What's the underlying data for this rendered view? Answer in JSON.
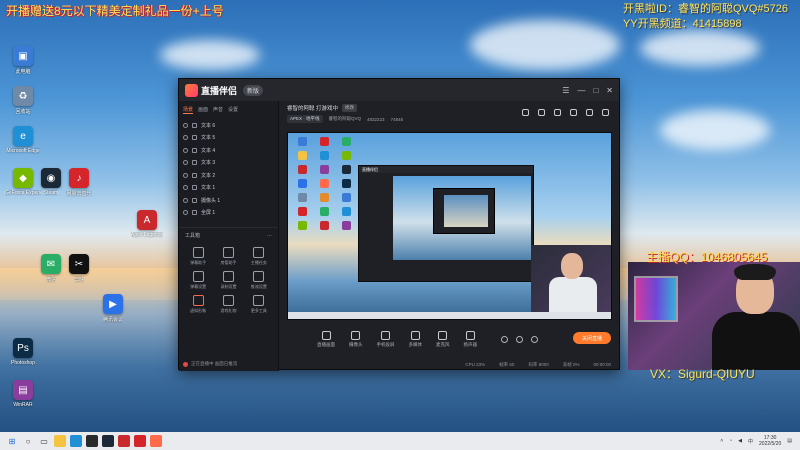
{
  "overlay": {
    "top_left": "开播赠送8元以下精美定制礼品一份+上号",
    "id_line": "开黑啦ID：睿智的阿聪QVQ#5726",
    "yy_line": "YY开黑频道：41415898",
    "qq_line": "主播QQ：1046805645",
    "vx_line": "VX：Sigurd-QIUYU"
  },
  "desktop_icons": [
    {
      "label": "此电脑",
      "color": "#3a7bd5",
      "glyph": "▣"
    },
    {
      "label": "回收站",
      "color": "#6f8aa6",
      "glyph": "♻"
    },
    {
      "label": "Microsoft Edge",
      "color": "#1f8fd6",
      "glyph": "e"
    },
    {
      "label": "GeForce Experience",
      "color": "#76b900",
      "glyph": "◆"
    },
    {
      "label": "Steam",
      "color": "#1b2838",
      "glyph": "◉"
    },
    {
      "label": "网易云音乐",
      "color": "#d6252a",
      "glyph": "♪"
    },
    {
      "label": "微信",
      "color": "#2aae67",
      "glyph": "✉"
    },
    {
      "label": "剪映",
      "color": "#111111",
      "glyph": "✂"
    },
    {
      "label": "腾讯会议",
      "color": "#2b72e8",
      "glyph": "▶"
    },
    {
      "label": "Apex Legends",
      "color": "#c9282d",
      "glyph": "A"
    },
    {
      "label": "Photoshop",
      "color": "#0b2b46",
      "glyph": "Ps"
    },
    {
      "label": "WinRAR",
      "color": "#8a3d9c",
      "glyph": "▤"
    }
  ],
  "app": {
    "name": "直播伴侣",
    "version": "新版",
    "window_controls": [
      "☰",
      "—",
      "□",
      "✕"
    ],
    "left_tabs": [
      "场景",
      "画面",
      "声音",
      "设置"
    ],
    "sources": [
      "文本 6",
      "文本 5",
      "文本 4",
      "文本 3",
      "文本 2",
      "文本 1",
      "摄像头 1",
      "全屏 1"
    ],
    "toolbox_title": "工具箱",
    "tools": [
      "弹幕助手",
      "房管助手",
      "主播任务",
      "弹幕设置",
      "录制设置",
      "推流设置",
      "虚拟形象",
      "游戏礼物",
      "更多工具"
    ],
    "left_footer": "正在直播中 画面已推流",
    "stream_title": "睿智的阿聪 打游戏中",
    "edit_label": "修改",
    "game": "APEX · 地平线",
    "anchor": "睿智的阿聪QVQ",
    "room_id": "4832223",
    "viewers": "74846",
    "toolbar": [
      "直播画面",
      "摄像头",
      "手机投屏",
      "多媒体",
      "麦克风",
      "扬声器"
    ],
    "live_button": "关闭直播",
    "status": [
      "CPU 23%",
      "帧率 60",
      "码率 8000",
      "丢帧 0%",
      "00:00:00"
    ]
  },
  "taskbar": {
    "time": "17:30",
    "date": "2022/5/20",
    "language": "中"
  }
}
